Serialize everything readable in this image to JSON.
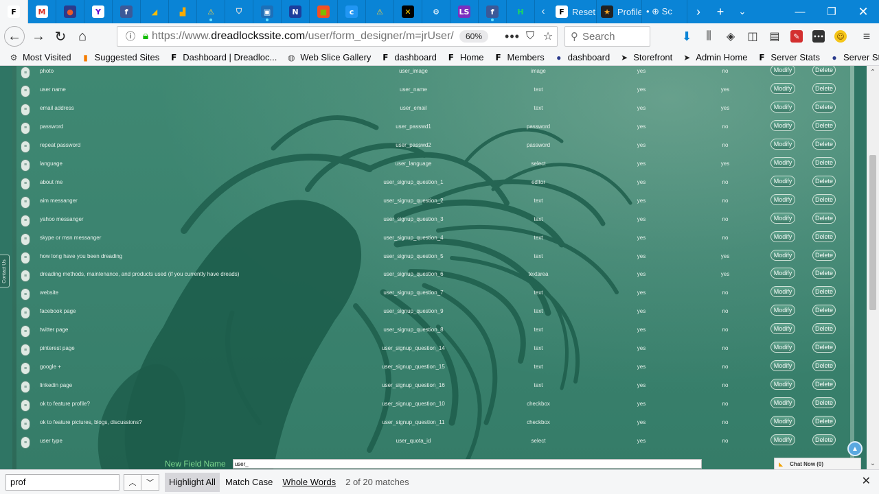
{
  "tabs": {
    "pinned": [
      {
        "name": "dreadlocks-tab-icon",
        "glyph": "𝗙",
        "bg": "#ffffff",
        "fg": "#000000",
        "dot": false
      },
      {
        "name": "gmail-tab-icon",
        "glyph": "M",
        "bg": "#ffffff",
        "fg": "#d93025",
        "dot": false
      },
      {
        "name": "firefox-tab-icon",
        "glyph": "●",
        "bg": "#2a3a8c",
        "fg": "#e85b2a",
        "dot": false
      },
      {
        "name": "yahoo-tab-icon",
        "glyph": "Y",
        "bg": "#ffffff",
        "fg": "#5f01d1",
        "dot": false
      },
      {
        "name": "facebook-tab-icon",
        "glyph": "f",
        "bg": "#3b5998",
        "fg": "#ffffff",
        "dot": false
      },
      {
        "name": "google-ads-tab-icon",
        "glyph": "◢",
        "bg": "#0a84d6",
        "fg": "#fbbc04",
        "dot": false
      },
      {
        "name": "analytics-tab-icon",
        "glyph": "▟",
        "bg": "#0a84d6",
        "fg": "#f9ab00",
        "dot": false
      },
      {
        "name": "warning-tab-icon",
        "glyph": "⚠",
        "bg": "#0a84d6",
        "fg": "#ffd43b",
        "dot": true
      },
      {
        "name": "shield-tab-icon",
        "glyph": "⛉",
        "bg": "#0a84d6",
        "fg": "#e0e0e0",
        "dot": false
      },
      {
        "name": "remote-desktop-tab-icon",
        "glyph": "▣",
        "bg": "#1c6fb8",
        "fg": "#ffffff",
        "dot": true
      },
      {
        "name": "news-tab-icon",
        "glyph": "N",
        "bg": "#1c3e9c",
        "fg": "#ffffff",
        "dot": false
      },
      {
        "name": "microsoft-tab-icon",
        "glyph": "■",
        "bg": "#f25022",
        "fg": "#7fba00",
        "dot": false
      },
      {
        "name": "c-tab-icon",
        "glyph": "c",
        "bg": "#2196f3",
        "fg": "#ffffff",
        "dot": false
      },
      {
        "name": "warning2-tab-icon",
        "glyph": "⚠",
        "bg": "#0a84d6",
        "fg": "#ffd43b",
        "dot": false
      },
      {
        "name": "jamaica-tab-icon",
        "glyph": "✕",
        "bg": "#000000",
        "fg": "#fed100",
        "dot": false
      },
      {
        "name": "settings-tab-icon",
        "glyph": "⚙",
        "bg": "#0a84d6",
        "fg": "#ffffff",
        "dot": false
      },
      {
        "name": "ls-tab-icon",
        "glyph": "LS",
        "bg": "#7b2fbf",
        "fg": "#ffffff",
        "dot": false
      },
      {
        "name": "facebook2-tab-icon",
        "glyph": "f",
        "bg": "#3b5998",
        "fg": "#ffffff",
        "dot": true
      },
      {
        "name": "hootsuite-tab-icon",
        "glyph": "H",
        "bg": "#0a84d6",
        "fg": "#1ed760",
        "dot": false
      }
    ],
    "titled": [
      {
        "name": "tab-reset",
        "title": "Reset",
        "glyph": "𝗙",
        "bg": "#ffffff",
        "fg": "#000000"
      },
      {
        "name": "tab-profile",
        "title": "Profile",
        "glyph": "★",
        "bg": "#222222",
        "fg": "#f5a623"
      },
      {
        "name": "tab-sc",
        "title": "• ⊕ Sc",
        "glyph": "",
        "bg": "",
        "fg": ""
      }
    ]
  },
  "nav": {
    "url_prefix": "https://www.",
    "url_host": "dreadlockssite.com",
    "url_path": "/user/form_designer/m=jrUser/v=a",
    "zoom": "60%",
    "search_placeholder": "Search"
  },
  "bookmarks": [
    {
      "name": "bookmark-most-visited",
      "label": "Most Visited",
      "icon": "⚙",
      "color": "#444444"
    },
    {
      "name": "bookmark-suggested-sites",
      "label": "Suggested Sites",
      "icon": "▮",
      "color": "#f57c00"
    },
    {
      "name": "bookmark-dashboard-dreadlocks",
      "label": "Dashboard | Dreadloc...",
      "icon": "𝗙",
      "color": "#000000"
    },
    {
      "name": "bookmark-web-slice-gallery",
      "label": "Web Slice Gallery",
      "icon": "◍",
      "color": "#555555"
    },
    {
      "name": "bookmark-dashboard",
      "label": "dashboard",
      "icon": "𝗙",
      "color": "#000000"
    },
    {
      "name": "bookmark-home",
      "label": "Home",
      "icon": "𝗙",
      "color": "#000000"
    },
    {
      "name": "bookmark-members",
      "label": "Members",
      "icon": "𝗙",
      "color": "#000000"
    },
    {
      "name": "bookmark-dashboard-2",
      "label": "dashboard",
      "icon": "●",
      "color": "#2a3a8c"
    },
    {
      "name": "bookmark-storefront",
      "label": "Storefront",
      "icon": "➤",
      "color": "#222222"
    },
    {
      "name": "bookmark-admin-home",
      "label": "Admin Home",
      "icon": "➤",
      "color": "#222222"
    },
    {
      "name": "bookmark-server-stats",
      "label": "Server Stats",
      "icon": "𝗙",
      "color": "#000000"
    },
    {
      "name": "bookmark-server-stats-2",
      "label": "Server Stats",
      "icon": "●",
      "color": "#2a3a8c"
    }
  ],
  "form": {
    "modify_label": "Modify",
    "delete_label": "Delete",
    "drag_glyph": "≡",
    "rows": [
      {
        "label": "photo",
        "name": "user_image",
        "type": "image",
        "required": "yes",
        "unique": "no"
      },
      {
        "label": "user name",
        "name": "user_name",
        "type": "text",
        "required": "yes",
        "unique": "yes"
      },
      {
        "label": "email address",
        "name": "user_email",
        "type": "text",
        "required": "yes",
        "unique": "yes"
      },
      {
        "label": "password",
        "name": "user_passwd1",
        "type": "password",
        "required": "yes",
        "unique": "no"
      },
      {
        "label": "repeat password",
        "name": "user_passwd2",
        "type": "password",
        "required": "yes",
        "unique": "no"
      },
      {
        "label": "language",
        "name": "user_language",
        "type": "select",
        "required": "yes",
        "unique": "yes"
      },
      {
        "label": "about me",
        "name": "user_signup_question_1",
        "type": "editor",
        "required": "yes",
        "unique": "no"
      },
      {
        "label": "aim messanger",
        "name": "user_signup_question_2",
        "type": "text",
        "required": "yes",
        "unique": "no"
      },
      {
        "label": "yahoo messanger",
        "name": "user_signup_question_3",
        "type": "text",
        "required": "yes",
        "unique": "no"
      },
      {
        "label": "skype or msn messanger",
        "name": "user_signup_question_4",
        "type": "text",
        "required": "yes",
        "unique": "no"
      },
      {
        "label": "how long have you been dreading",
        "name": "user_signup_question_5",
        "type": "text",
        "required": "yes",
        "unique": "yes"
      },
      {
        "label": "dreading methods, maintenance, and products used (if you currently have dreads)",
        "name": "user_signup_question_6",
        "type": "textarea",
        "required": "yes",
        "unique": "yes"
      },
      {
        "label": "website",
        "name": "user_signup_question_7",
        "type": "text",
        "required": "yes",
        "unique": "no"
      },
      {
        "label": "facebook page",
        "name": "user_signup_question_9",
        "type": "text",
        "required": "yes",
        "unique": "no"
      },
      {
        "label": "twitter page",
        "name": "user_signup_question_8",
        "type": "text",
        "required": "yes",
        "unique": "no"
      },
      {
        "label": "pinterest page",
        "name": "user_signup_question_14",
        "type": "text",
        "required": "yes",
        "unique": "no"
      },
      {
        "label": "google +",
        "name": "user_signup_question_15",
        "type": "text",
        "required": "yes",
        "unique": "no"
      },
      {
        "label": "linkedin page",
        "name": "user_signup_question_16",
        "type": "text",
        "required": "yes",
        "unique": "no"
      },
      {
        "label": "ok to feature profile?",
        "name": "user_signup_question_10",
        "type": "checkbox",
        "required": "yes",
        "unique": "no"
      },
      {
        "label": "ok to feature pictures, blogs, discussions?",
        "name": "user_signup_question_11",
        "type": "checkbox",
        "required": "yes",
        "unique": "no"
      },
      {
        "label": "user type",
        "name": "user_quota_id",
        "type": "select",
        "required": "yes",
        "unique": "no"
      }
    ],
    "new_field_label": "New Field Name",
    "new_field_value": "user_"
  },
  "side": {
    "contact_tab": "Contact Us",
    "chat_label": "Chat Now (0)"
  },
  "findbar": {
    "query": "prof",
    "highlight_all": "Highlight All",
    "match_case": "Match Case",
    "whole_words": "Whole Words",
    "status": "2 of 20 matches"
  },
  "colors": {
    "tabstrip": "#0a84d6",
    "page_bg": "#2f7564",
    "new_field_label": "#7dd98f"
  }
}
